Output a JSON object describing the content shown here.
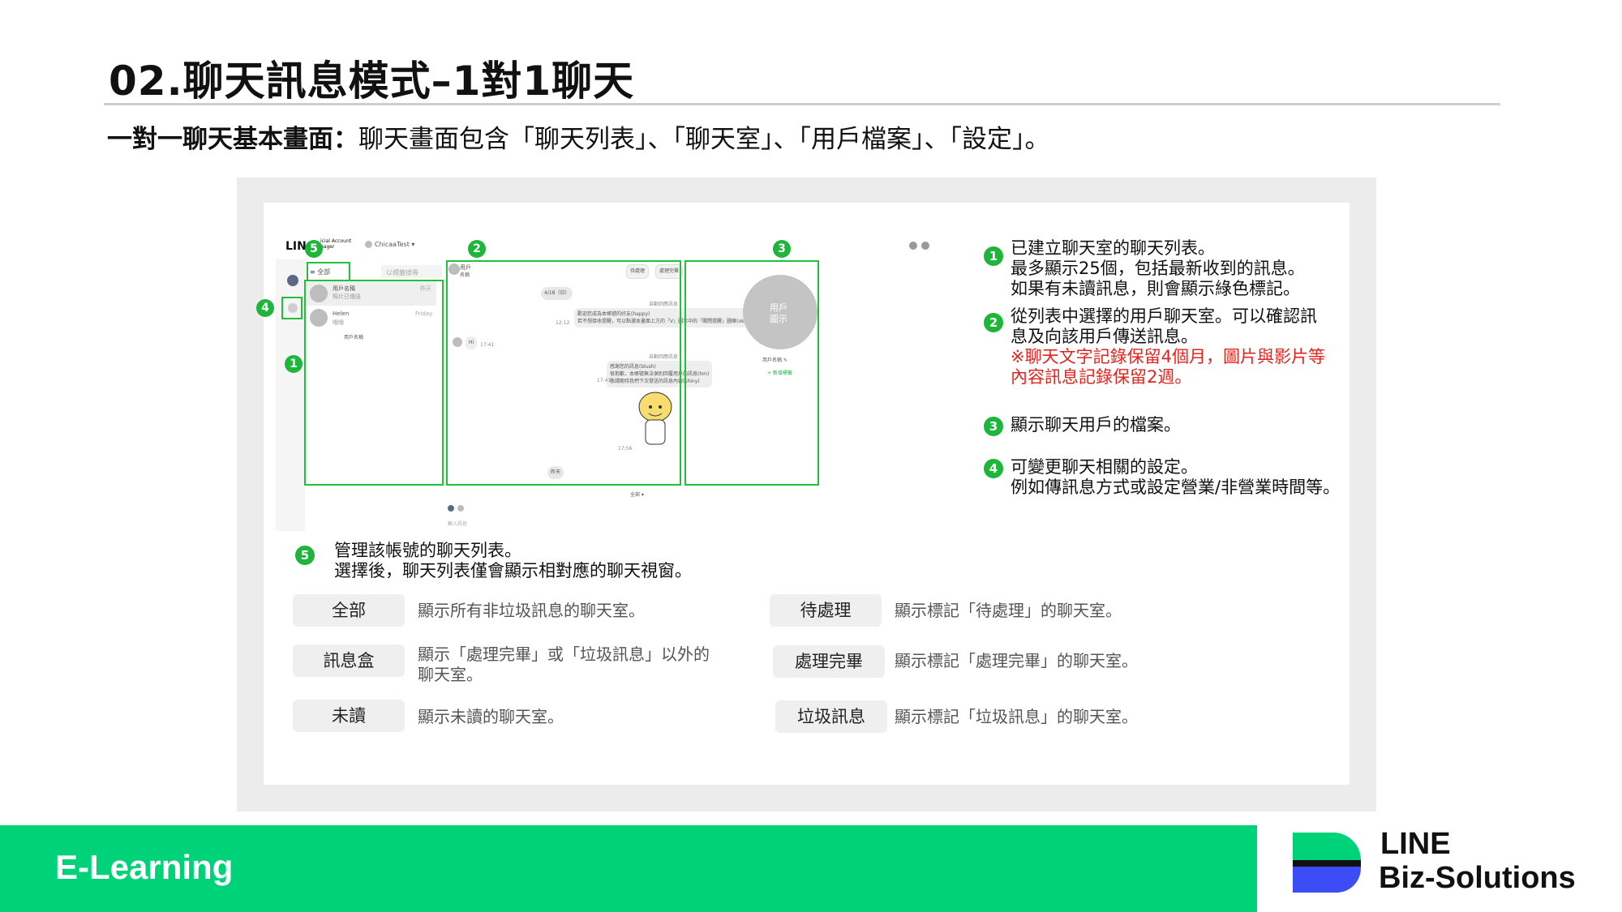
{
  "title": "02.聊天訊息模式–1對1聊天",
  "subtitle": {
    "bold": "一對一聊天基本畫面：",
    "rest": "聊天畫面包含「聊天列表」、「聊天室」、「用戶檔案」、「設定」。"
  },
  "mock": {
    "logo": "LIN",
    "logo_sub1": "icial Account",
    "logo_sub2": "nager",
    "account": "ChicaaTest ▾",
    "filter_all": "≡  全部",
    "search_placeholder": "以標籤搜尋",
    "list": [
      {
        "name": "用戶名稱",
        "preview": "照片已傳送",
        "time": "昨天"
      },
      {
        "name": "Helen",
        "preview": "哦哦",
        "time": "Friday"
      },
      {
        "name": "用戶名稱",
        "preview": "",
        "time": ""
      }
    ],
    "chat_header_name": "用戶",
    "chat_header_sub": "名稱",
    "btn_pending": "待處理",
    "btn_done": "處理完畢",
    "date_chip": "4/18（日）",
    "auto_reply": "自動回應訊息",
    "msg1_line1": "歡迎您成為本帳號的好友(happy)",
    "msg1_line2": "若不想接收提醒，可以點選本畫面上方的「V」圖示中的「關閉提醒」圖嘛(ok)",
    "msg1_time": "12:12",
    "hi_text": "Hi",
    "hi_time": "17:41",
    "msg2_line1": "感謝您的訊息(blush)",
    "msg2_line2": "很抱歉，本帳號無法個別回覆用戶的訊息(hm)",
    "msg2_line3": "敬請期待我們下次發送的訊息內容(shiny)",
    "msg2_time": "17:41",
    "sticker_time": "17:56",
    "today_chip": "昨天",
    "input_placeholder": "輸入訊息",
    "profile_avatar_l1": "用戶",
    "profile_avatar_l2": "圖示",
    "profile_name": "用戶名稱 ✎",
    "profile_add_tag": "+ 新增標籤",
    "menu_all": "全部 ▾"
  },
  "notes": [
    {
      "num": "1",
      "lines": [
        "已建立聊天室的聊天列表。",
        "最多顯示25個，包括最新收到的訊息。",
        "如果有未讀訊息，則會顯示綠色標記。"
      ]
    },
    {
      "num": "2",
      "lines": [
        "從列表中選擇的用戶聊天室。可以確認訊",
        "息及向該用戶傳送訊息。"
      ],
      "red_lines": [
        "※聊天文字記錄保留4個月，圖片與影片等",
        "內容訊息記錄保留2週。"
      ]
    },
    {
      "num": "3",
      "lines": [
        "顯示聊天用戶的檔案。"
      ]
    },
    {
      "num": "4",
      "lines": [
        "可變更聊天相關的設定。",
        "例如傳訊息方式或設定營業/非營業時間等。"
      ]
    },
    {
      "num": "5",
      "lines": [
        "管理該帳號的聊天列表。",
        "選擇後，聊天列表僅會顯示相對應的聊天視窗。"
      ]
    }
  ],
  "filters": [
    {
      "label": "全部",
      "desc": "顯示所有非垃圾訊息的聊天室。"
    },
    {
      "label": "訊息盒",
      "desc1": "顯示「處理完畢」或「垃圾訊息」以外的",
      "desc2": "聊天室。"
    },
    {
      "label": "未讀",
      "desc": "顯示未讀的聊天室。"
    },
    {
      "label": "待處理",
      "desc": "顯示標記「待處理」的聊天室。"
    },
    {
      "label": "處理完畢",
      "desc": "顯示標記「處理完畢」的聊天室。"
    },
    {
      "label": "垃圾訊息",
      "desc": "顯示標記「垃圾訊息」的聊天室。"
    }
  ],
  "footer": {
    "label": "E-Learning",
    "brand_line1": "LINE",
    "brand_line2": "Biz-Solutions"
  },
  "colors": {
    "accent_green": "#00d27a",
    "marker_green": "#1db53a",
    "warning_red": "#e5231e",
    "brand_blue": "#3d4df5"
  }
}
